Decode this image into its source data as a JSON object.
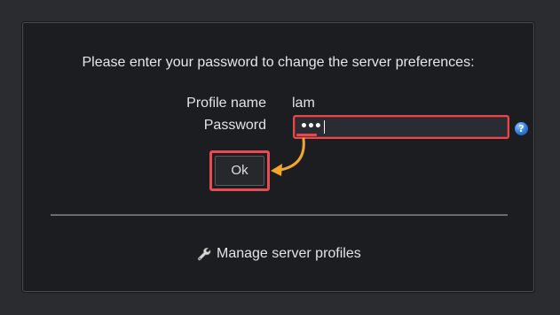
{
  "dialog": {
    "message": "Please enter your password to change the server preferences:",
    "profile_name_label": "Profile name",
    "profile_name_value": "lam",
    "password_label": "Password",
    "password_masked": "•••",
    "ok_label": "Ok",
    "manage_profiles_label": "Manage server profiles"
  },
  "icons": {
    "help": "help-icon",
    "manage": "wrench-icon"
  },
  "colors": {
    "highlight": "#e5484d",
    "arrow": "#f2a62b",
    "background": "#1c1d20"
  }
}
